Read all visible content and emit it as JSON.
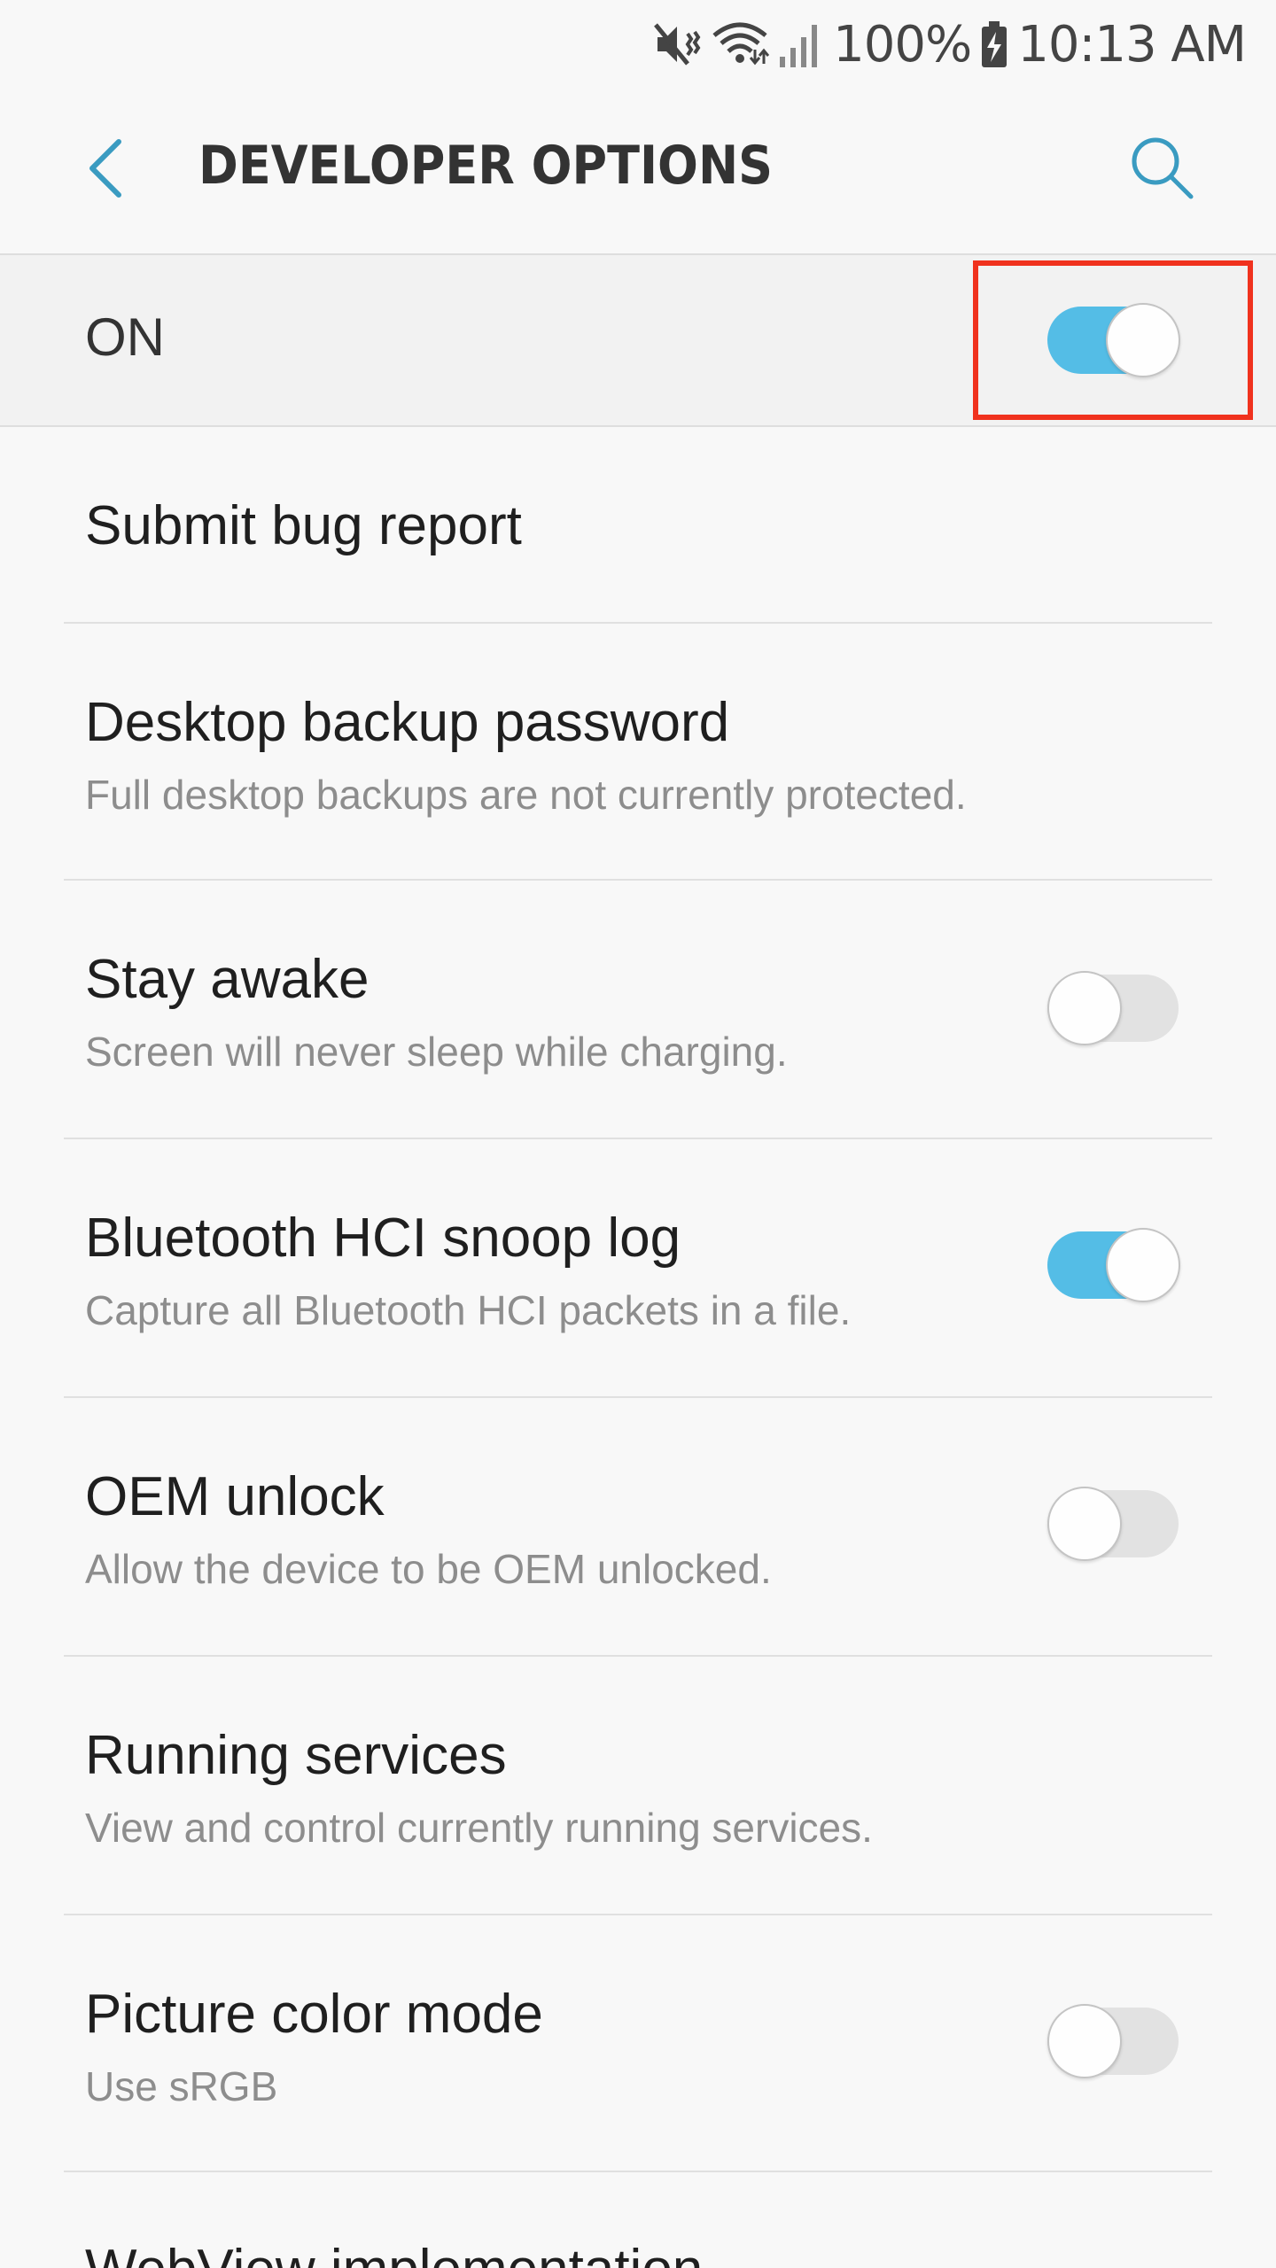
{
  "status_bar": {
    "battery": "100%",
    "time": "10:13 AM",
    "icons": [
      "mute-vibrate-icon",
      "wifi-icon",
      "signal-icon",
      "battery-charging-icon"
    ]
  },
  "header": {
    "title": "DEVELOPER OPTIONS",
    "back_icon": "chevron-left-icon",
    "search_icon": "search-icon",
    "accent_color": "#3a9bc1"
  },
  "master_switch": {
    "label": "ON",
    "checked": true,
    "highlight_color": "#f0321e"
  },
  "settings": [
    {
      "title": "Submit bug report",
      "summary": null,
      "has_switch": false
    },
    {
      "title": "Desktop backup password",
      "summary": "Full desktop backups are not currently protected.",
      "has_switch": false
    },
    {
      "title": "Stay awake",
      "summary": "Screen will never sleep while charging.",
      "has_switch": true,
      "checked": false
    },
    {
      "title": "Bluetooth HCI snoop log",
      "summary": "Capture all Bluetooth HCI packets in a file.",
      "has_switch": true,
      "checked": true
    },
    {
      "title": "OEM unlock",
      "summary": "Allow the device to be OEM unlocked.",
      "has_switch": true,
      "checked": false
    },
    {
      "title": "Running services",
      "summary": "View and control currently running services.",
      "has_switch": false
    },
    {
      "title": "Picture color mode",
      "summary": "Use sRGB",
      "has_switch": true,
      "checked": false
    },
    {
      "title": "WebView implementation",
      "summary": null,
      "has_switch": false
    }
  ],
  "colors": {
    "switch_on": "#54bde6",
    "switch_off": "#e2e2e2"
  }
}
